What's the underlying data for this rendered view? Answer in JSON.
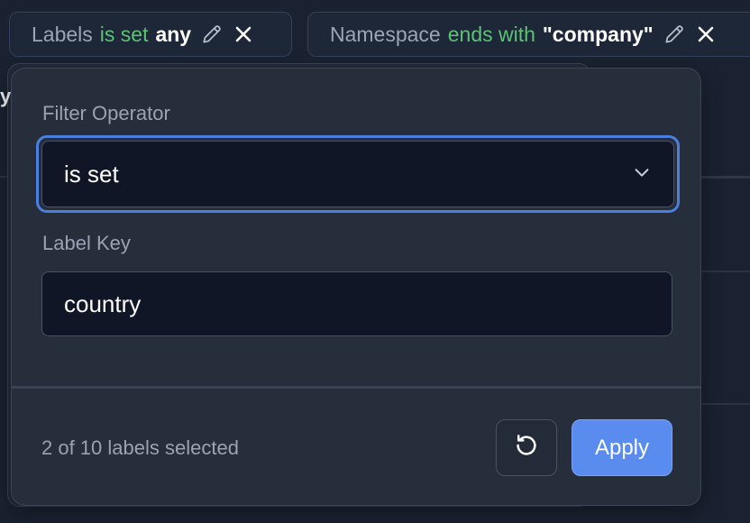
{
  "filter_chips": [
    {
      "field": "Labels",
      "operator": "is set",
      "value": "any"
    },
    {
      "field": "Namespace",
      "operator": "ends with",
      "value": "\"company\""
    }
  ],
  "background": {
    "partial_text": "y"
  },
  "popover": {
    "operator_label": "Filter Operator",
    "operator_selected": "is set",
    "key_label": "Label Key",
    "key_value": "country",
    "footer_status": "2 of 10 labels selected",
    "apply_label": "Apply"
  },
  "icons": {
    "edit": "pencil-icon",
    "remove": "close-icon",
    "dropdown": "chevron-down-icon",
    "reset": "reset-icon"
  },
  "colors": {
    "page_bg": "#1a2130",
    "popover_bg": "#262d3b",
    "input_bg": "#111626",
    "accent": "#5a8cf0",
    "focus_ring": "#4a7fe0",
    "operator_green": "#5cc276",
    "muted_text": "#9aa3b2"
  }
}
